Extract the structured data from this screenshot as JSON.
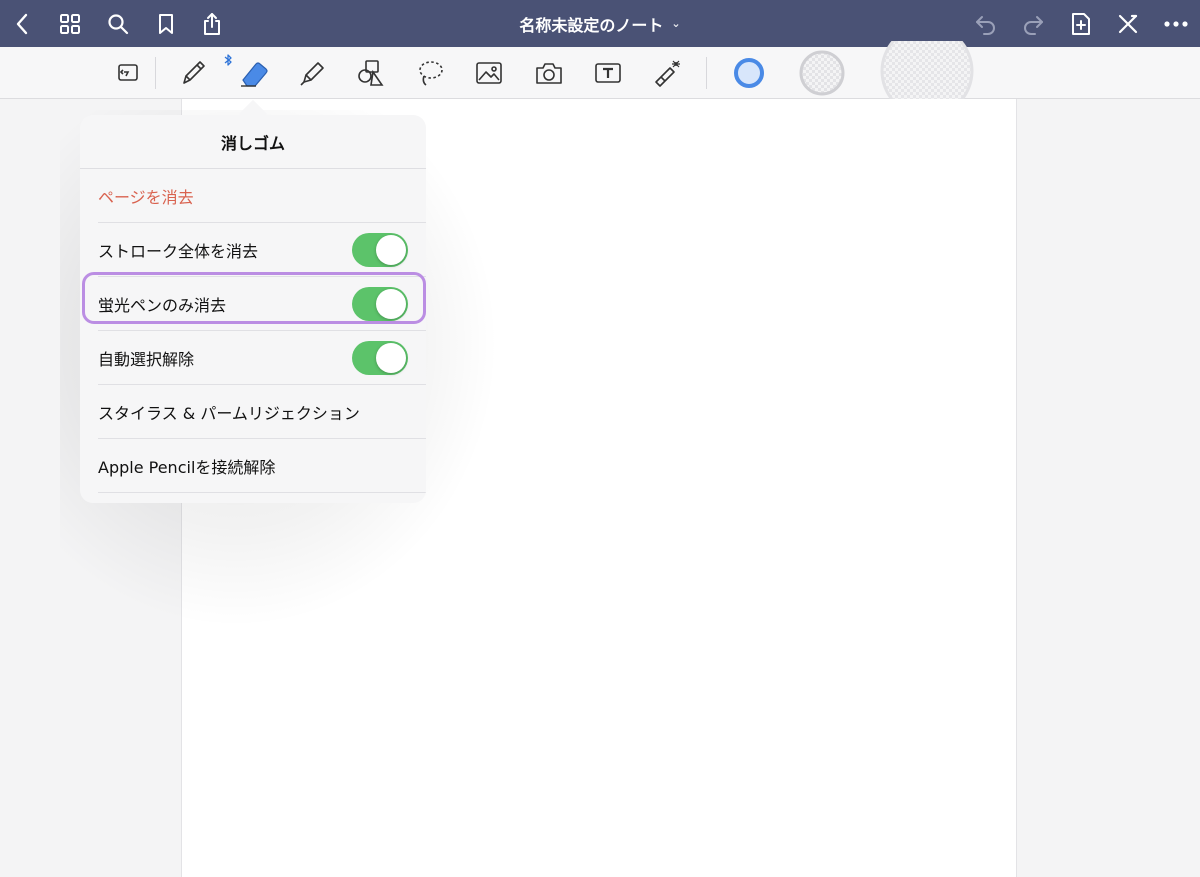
{
  "navbar": {
    "title": "名称未設定のノート",
    "title_chevron": "⌄",
    "icons": [
      "back-chevron-icon",
      "grid-icon",
      "search-icon",
      "bookmark-icon",
      "share-icon",
      "undo-icon",
      "redo-icon",
      "add-page-icon",
      "close-pen-icon",
      "more-icon"
    ]
  },
  "toolbar": {
    "tools": [
      "read-mode-icon",
      "pen-icon",
      "eraser-icon",
      "highlighter-icon",
      "shapes-icon",
      "lasso-icon",
      "image-icon",
      "camera-icon",
      "text-box-icon",
      "laser-pointer-icon"
    ],
    "selected_tool": "eraser",
    "colors": {
      "eraser_blue": "#4a8ae6",
      "size_small": "#cfcfd3",
      "size_large": "#e2e2e5"
    }
  },
  "popover": {
    "title": "消しゴム",
    "items": [
      {
        "label": "ページを消去",
        "type": "destructive"
      },
      {
        "label": "ストローク全体を消去",
        "toggle": true
      },
      {
        "label": "蛍光ペンのみ消去",
        "toggle": true,
        "highlighted": true
      },
      {
        "label": "自動選択解除",
        "toggle": true
      },
      {
        "label": "スタイラス & パームリジェクション"
      },
      {
        "label": "Apple Pencilを接続解除"
      }
    ],
    "colors": {
      "destructive": "#d9624f",
      "toggle_on": "#5cc36a",
      "highlight_ring": "#bb8ee3"
    }
  }
}
